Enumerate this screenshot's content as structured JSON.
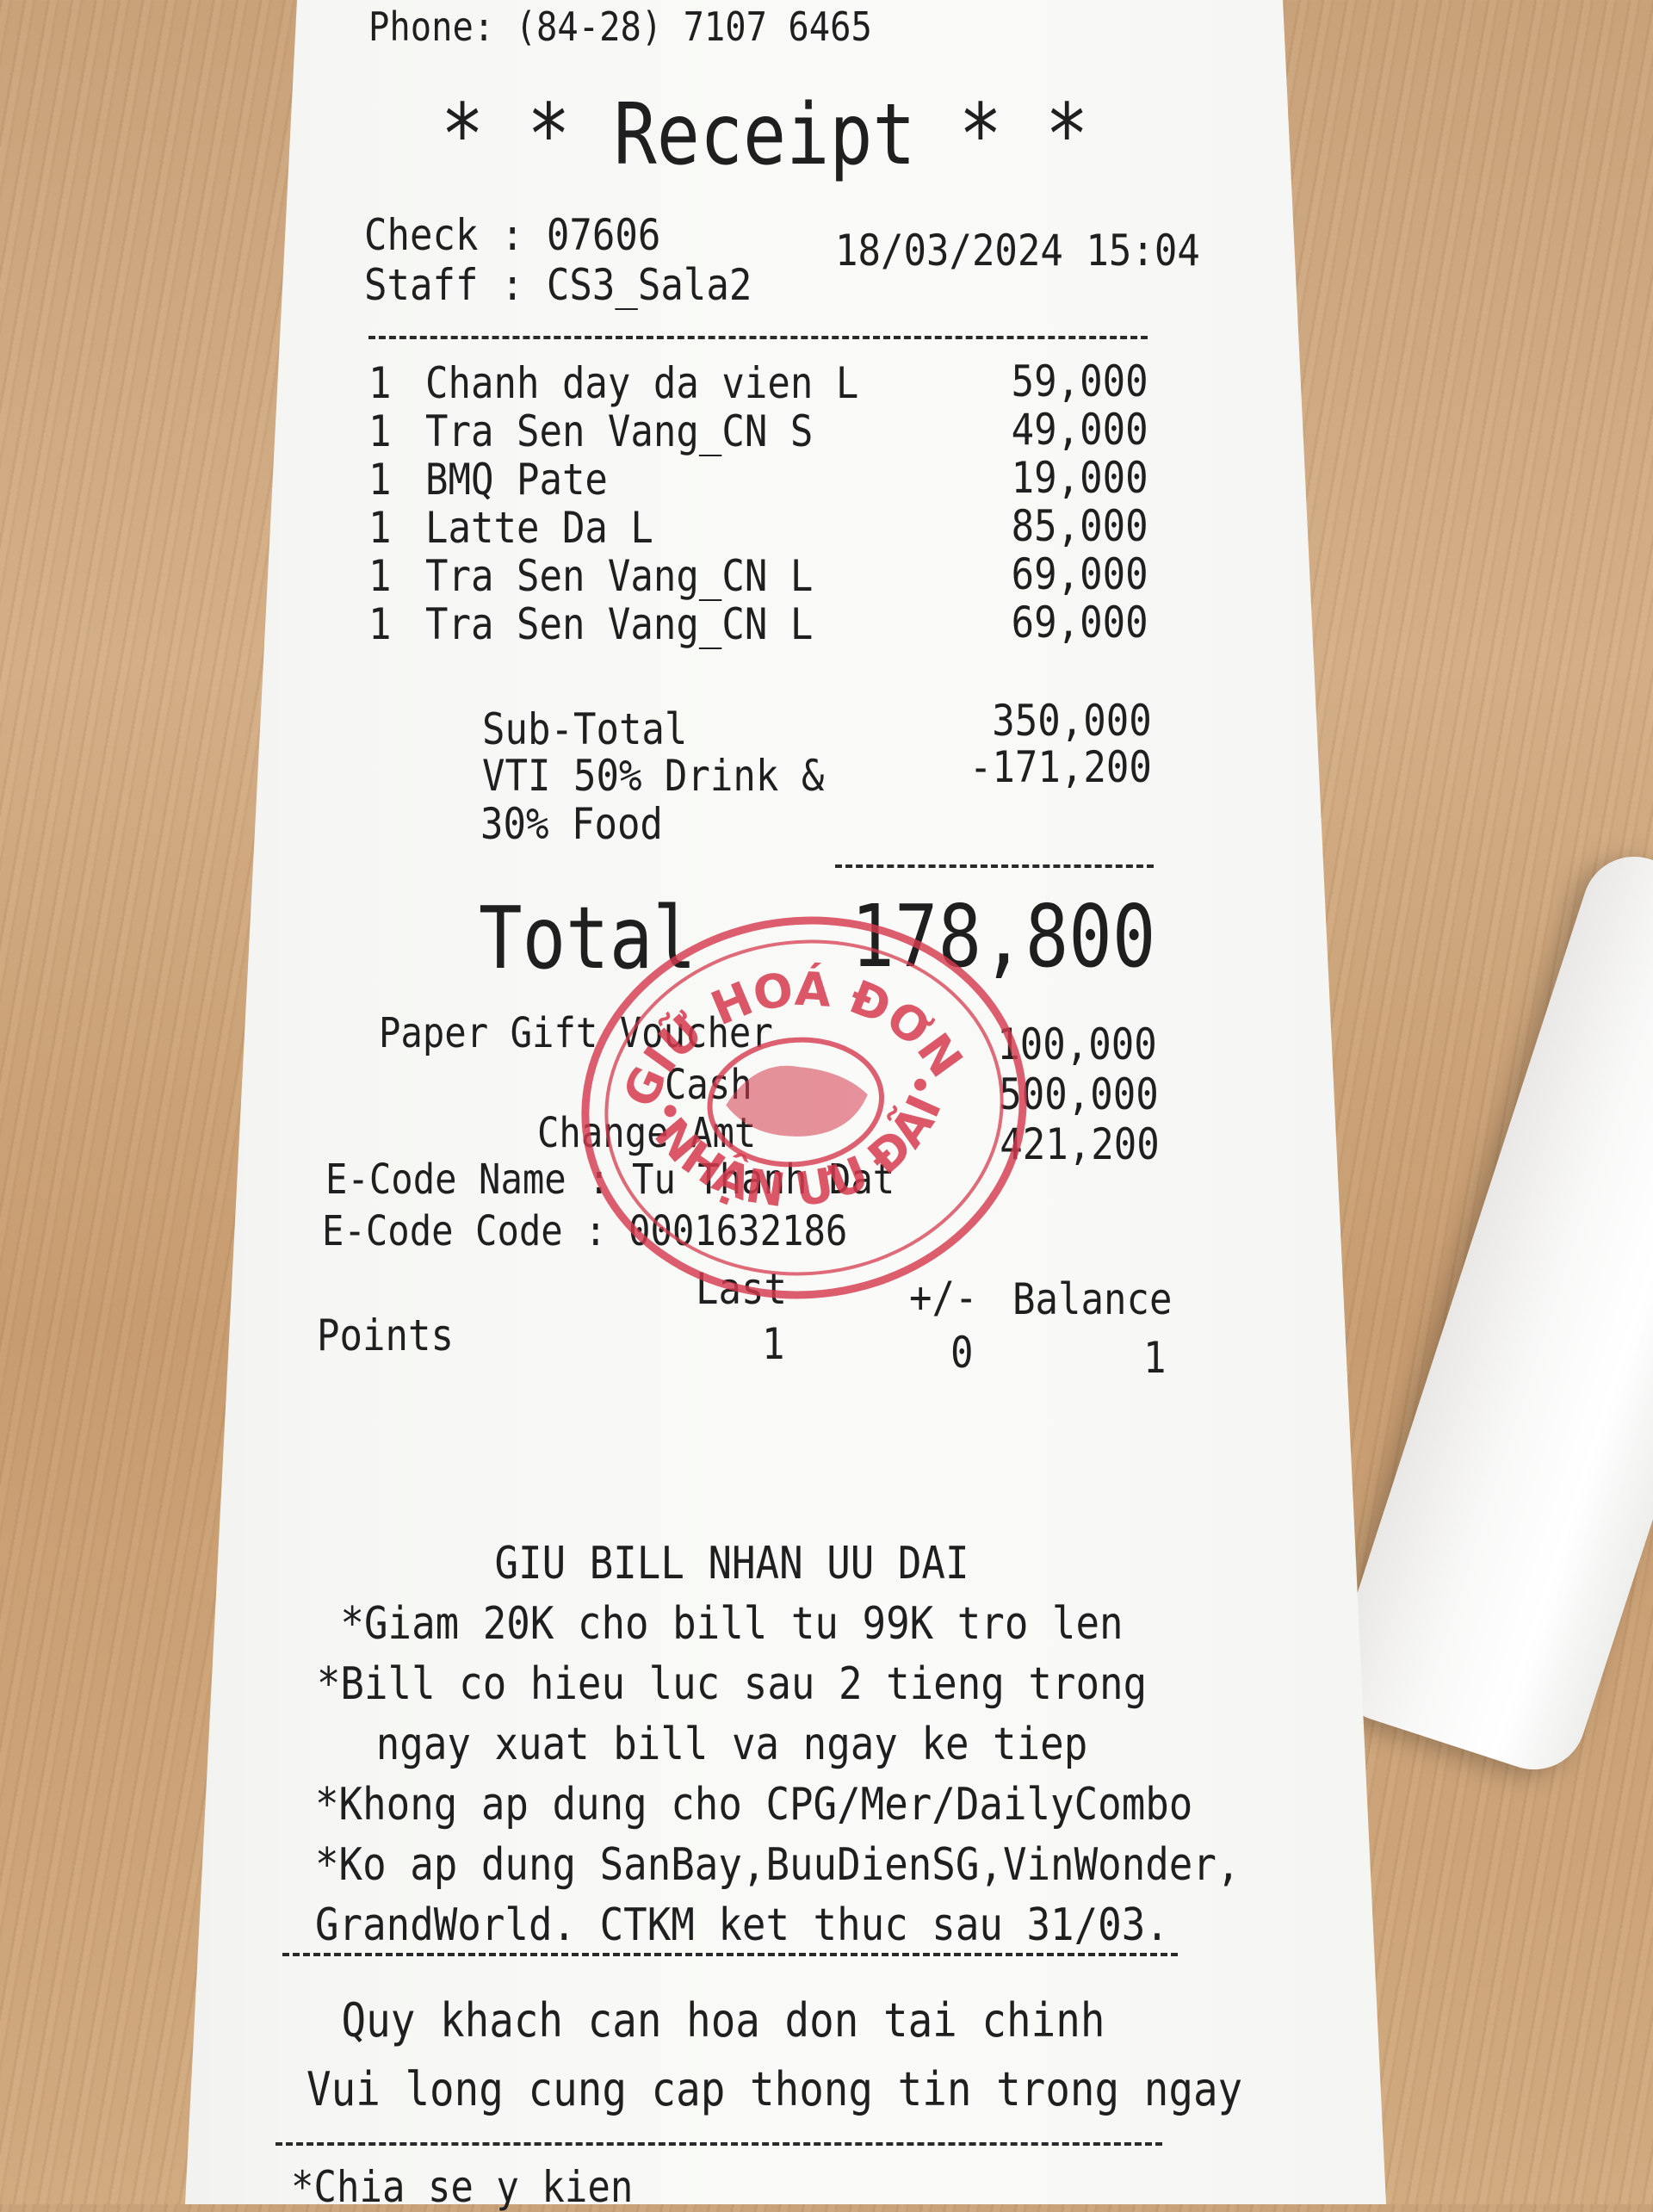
{
  "receipt": {
    "header_partial": "Phone: (84-28) 7107 6465",
    "title": "* * Receipt * *",
    "check": "Check : 07606",
    "datetime": "18/03/2024 15:04",
    "staff": "Staff : CS3_Sala2",
    "items": [
      {
        "qty": "1",
        "name": "Chanh day da vien L",
        "price": "59,000"
      },
      {
        "qty": "1",
        "name": "Tra Sen Vang_CN S",
        "price": "49,000"
      },
      {
        "qty": "1",
        "name": "BMQ Pate",
        "price": "19,000"
      },
      {
        "qty": "1",
        "name": "Latte Da L",
        "price": "85,000"
      },
      {
        "qty": "1",
        "name": "Tra Sen Vang_CN L",
        "price": "69,000"
      },
      {
        "qty": "1",
        "name": "Tra Sen Vang_CN L",
        "price": "69,000"
      }
    ],
    "subtotal_label": "Sub-Total",
    "subtotal_value": "350,000",
    "discount_label_1": "VTI 50% Drink &",
    "discount_label_2": "30% Food",
    "discount_value": "-171,200",
    "total_label": "Total",
    "total_value": "178,800",
    "voucher_label": "Paper Gift Voucher",
    "voucher_value": "100,000",
    "cash_label": "Cash",
    "cash_value": "500,000",
    "change_label": "Change Amt",
    "change_value": "421,200",
    "ecode_name": "E-Code Name : Tu Thanh Dat",
    "ecode_code": "E-Code Code : 0001632186",
    "points_headers": {
      "last": "Last",
      "delta": "+/-",
      "balance": "Balance"
    },
    "points_label": "Points",
    "points_values": {
      "last": "1",
      "delta": "0",
      "balance": "1"
    },
    "promo_lines": [
      "GIU BILL NHAN UU DAI",
      "*Giam 20K cho bill tu 99K tro len",
      "*Bill co hieu luc sau 2 tieng trong",
      "ngay xuat bill va ngay ke tiep",
      "*Khong ap dung cho CPG/Mer/DailyCombo",
      "*Ko ap dung SanBay,BuuDienSG,VinWonder,",
      "GrandWorld. CTKM ket thuc sau 31/03."
    ],
    "footer_lines": [
      "Quy khach can hoa don tai chinh",
      "Vui long cung cap thong tin trong ngay"
    ],
    "footer_partial": "*Chia se y kien"
  },
  "stamp": {
    "top_text": "GIỮ HOÁ ĐƠN",
    "bottom_text": "NHẬN ƯU ĐÃI",
    "color": "#d63a4e"
  }
}
